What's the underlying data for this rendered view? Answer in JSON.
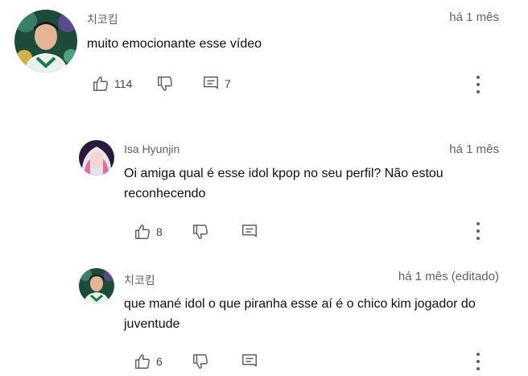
{
  "colors": {
    "text": "#0f0f0f",
    "secondary": "#606060",
    "background": "#ffffff"
  },
  "comments": [
    {
      "author": "치코킴",
      "time": "há 1 mês",
      "text": "muito emocionante esse vídeo",
      "likes": "114",
      "replies": "7"
    },
    {
      "author": "Isa Hyunjin",
      "time": "há 1 mês",
      "text": "Oi amiga qual é esse idol kpop no seu perfil? Não estou reconhecendo",
      "likes": "8"
    },
    {
      "author": "치코킴",
      "time": "há 1 mês (editado)",
      "text": "que mané idol o que piranha esse aí é o chico kim jogador do juventude",
      "likes": "6"
    }
  ]
}
